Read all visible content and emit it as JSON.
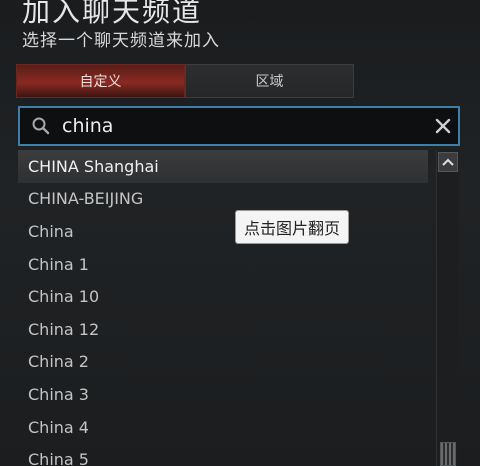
{
  "header": {
    "title": "加入聊天频道",
    "subtitle": "选择一个聊天频道来加入"
  },
  "tabs": [
    {
      "label": "自定义",
      "active": true
    },
    {
      "label": "区域",
      "active": false
    }
  ],
  "search": {
    "value": "china",
    "icon": "search-icon",
    "clear_icon": "close-icon"
  },
  "channels": [
    "CHINA Shanghai",
    "CHINA-BEIJING",
    "China",
    "China 1",
    "China 10",
    "China 12",
    "China 2",
    "China 3",
    "China 4",
    "China 5"
  ],
  "tooltip": {
    "text": "点击图片翻页"
  },
  "colors": {
    "accent_tab": "#8a2a22",
    "search_border": "#3d7fa8",
    "background": "#1d1f21"
  }
}
